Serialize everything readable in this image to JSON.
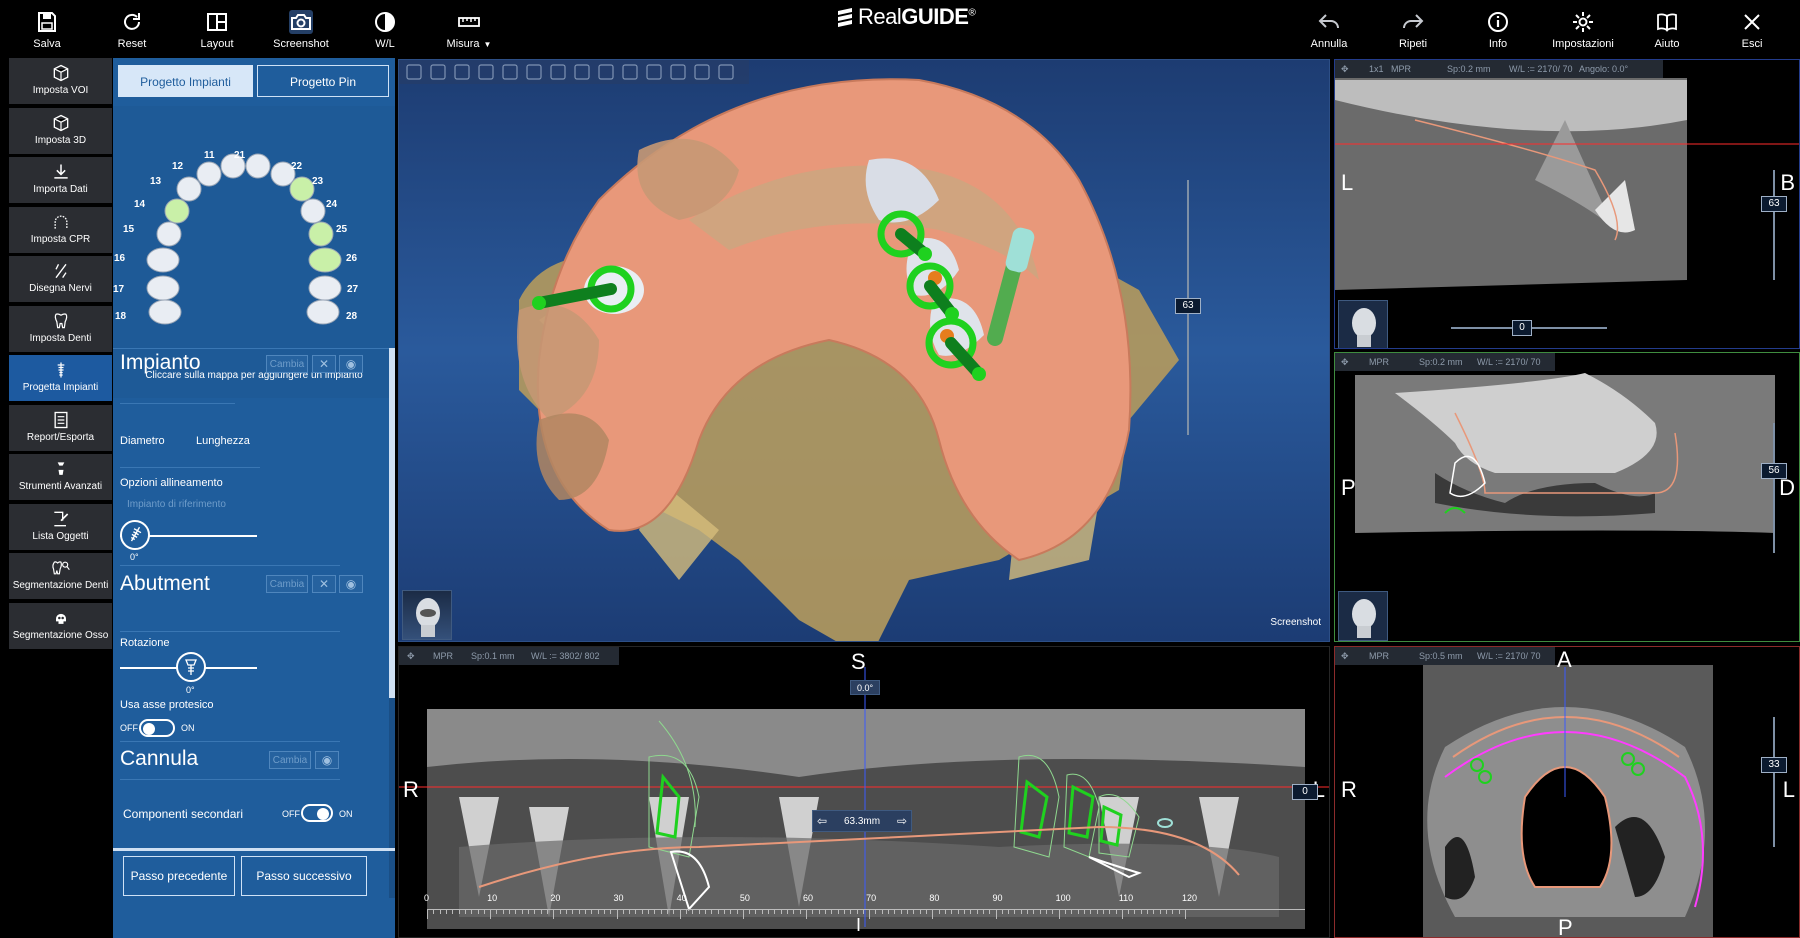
{
  "app": {
    "logo_prefix": "Real",
    "logo_bold": "GUIDE",
    "logo_mark": "®"
  },
  "toolbar": {
    "left": [
      {
        "label": "Salva",
        "icon": "save-icon"
      },
      {
        "label": "Reset",
        "icon": "reset-icon"
      },
      {
        "label": "Layout",
        "icon": "layout-icon"
      },
      {
        "label": "Screenshot",
        "icon": "camera-icon"
      },
      {
        "label": "W/L",
        "icon": "contrast-icon"
      },
      {
        "label": "Misura",
        "icon": "ruler-icon"
      }
    ],
    "right": [
      {
        "label": "Annulla",
        "icon": "undo-icon"
      },
      {
        "label": "Ripeti",
        "icon": "redo-icon"
      },
      {
        "label": "Info",
        "icon": "info-icon"
      },
      {
        "label": "Impostazioni",
        "icon": "gear-icon"
      },
      {
        "label": "Aiuto",
        "icon": "book-icon"
      },
      {
        "label": "Esci",
        "icon": "close-icon"
      }
    ]
  },
  "left_tools": [
    {
      "label": "Imposta VOI",
      "icon": "cube-icon"
    },
    {
      "label": "Imposta 3D",
      "icon": "cube-3d-icon"
    },
    {
      "label": "Importa Dati",
      "icon": "download-icon"
    },
    {
      "label": "Imposta CPR",
      "icon": "arch-icon"
    },
    {
      "label": "Disegna Nervi",
      "icon": "nerve-icon"
    },
    {
      "label": "Imposta Denti",
      "icon": "tooth-icon"
    },
    {
      "label": "Progetta Impianti",
      "icon": "implant-icon"
    },
    {
      "label": "Report/Esporta",
      "icon": "report-icon"
    },
    {
      "label": "Strumenti Avanzati",
      "icon": "advanced-tools-icon"
    },
    {
      "label": "Lista Oggetti",
      "icon": "list-edit-icon"
    },
    {
      "label": "Segmentazione Denti",
      "icon": "teeth-segmentation-icon"
    },
    {
      "label": "Segmentazione Osso",
      "icon": "skull-icon"
    }
  ],
  "left_tools_active": "Progetta Impianti",
  "panel": {
    "tabs": [
      "Progetto Impianti",
      "Progetto Pin"
    ],
    "active_tab": "Progetto Impianti",
    "tooth_numbers": [
      "11",
      "12",
      "13",
      "14",
      "15",
      "16",
      "17",
      "18",
      "21",
      "22",
      "23",
      "24",
      "25",
      "26",
      "27",
      "28"
    ],
    "selected_teeth": [
      "14",
      "23",
      "25",
      "26"
    ],
    "map_note": "Cliccare sulla mappa per aggiungere un impianto",
    "impianto": {
      "title": "Impianto",
      "change": "Cambia",
      "diametro": "Diametro",
      "lunghezza": "Lunghezza",
      "opzioni": "Opzioni allineamento",
      "riferimento": "Impianto di riferimento",
      "angle": "0°"
    },
    "abutment": {
      "title": "Abutment",
      "change": "Cambia",
      "rotazione": "Rotazione",
      "angle": "0°",
      "asse": "Usa asse protesico",
      "off": "OFF",
      "on": "ON"
    },
    "cannula": {
      "title": "Cannula",
      "change": "Cambia",
      "secondari": "Componenti secondari",
      "off": "OFF",
      "on": "ON"
    },
    "prev": "Passo precedente",
    "next": "Passo successivo"
  },
  "viewport_3d": {
    "slider_value": "63",
    "screenshot_label": "Screenshot"
  },
  "viewport_top_right": {
    "header": "1x1",
    "mode": "MPR",
    "spacing": "Sp:0.2 mm",
    "wl": "W/L := 2170/ 70",
    "angle": "Angolo: 0.0°",
    "slider_value": "63",
    "hslider_value": "0",
    "left": "L",
    "right": "B"
  },
  "viewport_mid_right": {
    "mode": "MPR",
    "spacing": "Sp:0.2 mm",
    "wl": "W/L := 2170/ 70",
    "slider_value": "56",
    "left": "P",
    "right": "D"
  },
  "viewport_bottom_right": {
    "mode": "MPR",
    "spacing": "Sp:0.5 mm",
    "wl": "W/L := 2170/ 70",
    "slider_value": "33",
    "top": "A",
    "bottom": "P",
    "left": "R",
    "right": "L"
  },
  "viewport_panoramic": {
    "mode": "MPR",
    "spacing": "Sp:0.1 mm",
    "wl": "W/L := 3802/ 802",
    "top": "S",
    "bottom": "I",
    "left": "R",
    "right": "L",
    "rotation": "0.0°",
    "distance": "63.3mm",
    "slider_value": "0",
    "ticks": [
      "0",
      "10",
      "20",
      "30",
      "40",
      "50",
      "60",
      "70",
      "80",
      "90",
      "100",
      "110",
      "120"
    ]
  },
  "colors": {
    "panel": "#1f5d9c",
    "tool_active": "#1d5aa0",
    "implant_green": "#1fd11f",
    "soft_tissue": "#e8987a",
    "bone": "#c2a86a"
  }
}
